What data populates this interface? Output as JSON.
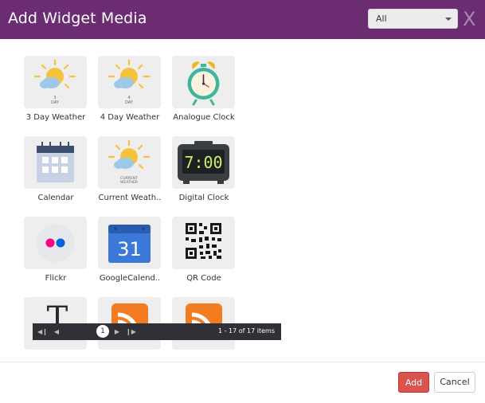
{
  "modal": {
    "title": "Add Widget Media",
    "close_label": "X",
    "filter": {
      "selected": "All"
    }
  },
  "widgets": [
    {
      "label": "3 Day Weather",
      "icon": "weather-3day-icon",
      "sub": "3\nDAY"
    },
    {
      "label": "4 Day Weather",
      "icon": "weather-4day-icon",
      "sub": "4\nDAY"
    },
    {
      "label": "Analogue Clock",
      "icon": "alarm-clock-icon"
    },
    {
      "label": "Calendar",
      "icon": "calendar-icon"
    },
    {
      "label": "Current Weath..",
      "icon": "current-weather-icon",
      "sub": "CURRENT\nWEATHER"
    },
    {
      "label": "Digital Clock",
      "icon": "digital-clock-icon",
      "time": "7:00"
    },
    {
      "label": "Flickr",
      "icon": "flickr-icon"
    },
    {
      "label": "GoogleCalend..",
      "icon": "google-calendar-icon",
      "day": "31"
    },
    {
      "label": "QR Code",
      "icon": "qr-code-icon"
    },
    {
      "label": "",
      "icon": "text-icon"
    },
    {
      "label": "",
      "icon": "rss-icon"
    },
    {
      "label": "",
      "icon": "rss-icon"
    }
  ],
  "pager": {
    "current_page": "1",
    "info": "1 - 17 of 17 items"
  },
  "footer": {
    "add_label": "Add",
    "cancel_label": "Cancel"
  },
  "colors": {
    "header": "#6b2c72",
    "add_button": "#d9534f",
    "pager_bg": "#2f3136"
  }
}
